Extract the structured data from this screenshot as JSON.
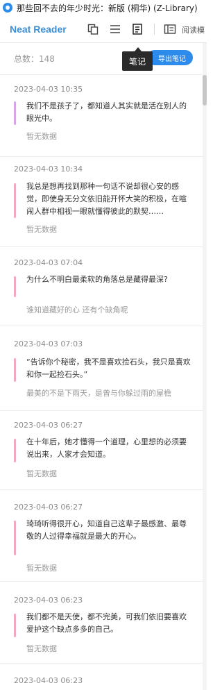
{
  "window": {
    "title": "那些回不去的年少时光：新版 (桐华) (Z-Library)"
  },
  "toolbar": {
    "brand": "Neat Reader",
    "icons": [
      "copy-icon",
      "list-icon",
      "notes-icon",
      "reading-mode-icon"
    ],
    "read_mode_label": "阅读模",
    "tooltip": "笔记"
  },
  "notes_panel": {
    "total_label": "总数：148",
    "export_label": "导出笔记",
    "notes": [
      {
        "date": "2023-04-03 10:35",
        "text": "我们不是孩子了，都知道人其实就是活在别人的眼光中。",
        "comment": "暂无数据",
        "color": "#d8a6e8"
      },
      {
        "date": "2023-04-03 10:34",
        "text": "我总是想再找到那种一句话不说却很心安的感觉，即使身无分文依旧能开怀大笑的积极，在喧闹人群中相视一眼就懂得彼此的默契……",
        "comment": "暂无数据",
        "color": "#f0a8c0"
      },
      {
        "date": "2023-04-03 07:04",
        "text": "为什么不明白最柔软的角落总是藏得最深?",
        "comment": "谁知道藏好的心 还有个缺角呢",
        "color": "#f0a8c0"
      },
      {
        "date": "2023-04-03 07:03",
        "text": "“告诉你个秘密，我不是喜欢捡石头，我只是喜欢和你一起捡石头。”",
        "comment": "最美的不是下雨天，是曾与你躲过雨的屋檐",
        "color": "#f0a8c0"
      },
      {
        "date": "2023-04-03 06:27",
        "text": "在十年后，她才懂得一个道理，心里想的必须要说出来，人家才会知道。",
        "comment": "暂无数据",
        "color": "#f0a8c0"
      },
      {
        "date": "2023-04-03 06:27",
        "text": "琦琦听得很开心，知道自己这辈子最感激、最尊敬的人过得幸福就是最大的开心。",
        "comment": "暂无数据",
        "color": "#f0a8c0"
      },
      {
        "date": "2023-04-03 06:23",
        "text": "我们都不是天使，都不完美，可我们依旧要喜欢爱护这个缺点多多的自己。",
        "comment": "暂无数据",
        "color": "#f0a8c0"
      },
      {
        "date": "2023-04-03 06:23",
        "text": "",
        "comment": "",
        "color": "#f0a8c0"
      }
    ]
  }
}
